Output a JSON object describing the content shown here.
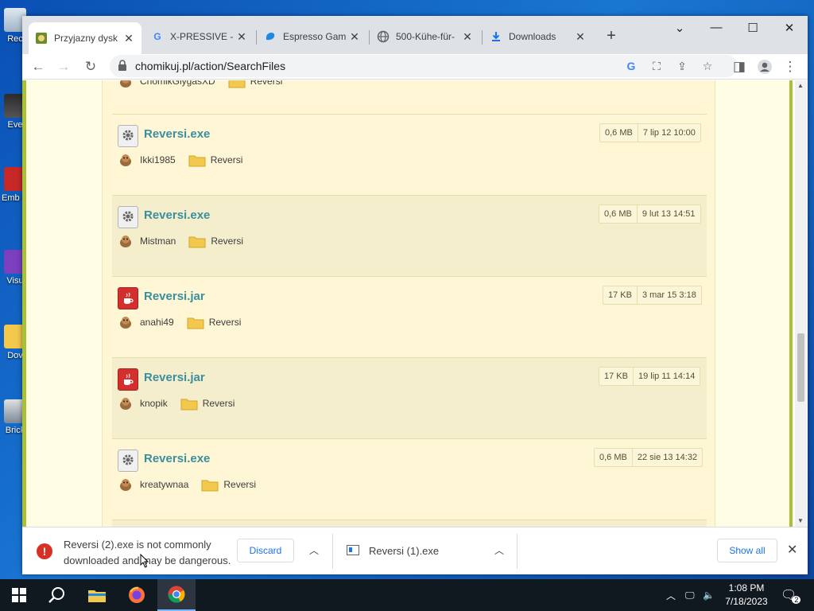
{
  "desktop": {
    "icons": [
      {
        "label": "Rec"
      },
      {
        "label": "Eve"
      },
      {
        "label": "Emb De"
      },
      {
        "label": "Visu"
      },
      {
        "label": "Dov"
      },
      {
        "label": "Brick"
      }
    ]
  },
  "tabs": [
    {
      "title": "Przyjazny dysk",
      "icon": "chomikuj-favicon",
      "active": true
    },
    {
      "title": "X-PRESSIVE - G",
      "icon": "google-icon"
    },
    {
      "title": "Espresso Gam",
      "icon": "espresso-icon"
    },
    {
      "title": "500-Kühe-für-",
      "icon": "globe-icon"
    },
    {
      "title": "Downloads",
      "icon": "download-icon"
    }
  ],
  "toolbar": {
    "url": "chomikuj.pl/action/SearchFiles"
  },
  "results": {
    "partial_row": {
      "owner": "ChomikGlygasXD",
      "folder": "Reversi"
    },
    "rows": [
      {
        "name": "Reversi.exe",
        "type": "exe",
        "size": "0,6 MB",
        "date": "7 lip 12 10:00",
        "owner": "Ikki1985",
        "folder": "Reversi"
      },
      {
        "name": "Reversi.exe",
        "type": "exe",
        "size": "0,6 MB",
        "date": "9 lut 13 14:51",
        "owner": "Mistman",
        "folder": "Reversi"
      },
      {
        "name": "Reversi.jar",
        "type": "jar",
        "size": "17 KB",
        "date": "3 mar 15 3:18",
        "owner": "anahi49",
        "folder": "Reversi"
      },
      {
        "name": "Reversi.jar",
        "type": "jar",
        "size": "17 KB",
        "date": "19 lip 11 14:14",
        "owner": "knopik",
        "folder": "Reversi"
      },
      {
        "name": "Reversi.exe",
        "type": "exe",
        "size": "0,6 MB",
        "date": "22 sie 13 14:32",
        "owner": "kreatywnaa",
        "folder": "Reversi"
      }
    ]
  },
  "downloads": {
    "warning_line1": "Reversi (2).exe is not commonly",
    "warning_line2": "downloaded and may be dangerous.",
    "discard_label": "Discard",
    "second_file": "Reversi (1).exe",
    "show_all_label": "Show all"
  },
  "taskbar": {
    "time": "1:08 PM",
    "date": "7/18/2023",
    "notification_count": "2"
  },
  "colors": {
    "link": "#3a8f9e",
    "page_bg": "#fff6d6",
    "accent_green": "#a7c236",
    "warning": "#d93025",
    "chrome_blue": "#1a73e8"
  }
}
